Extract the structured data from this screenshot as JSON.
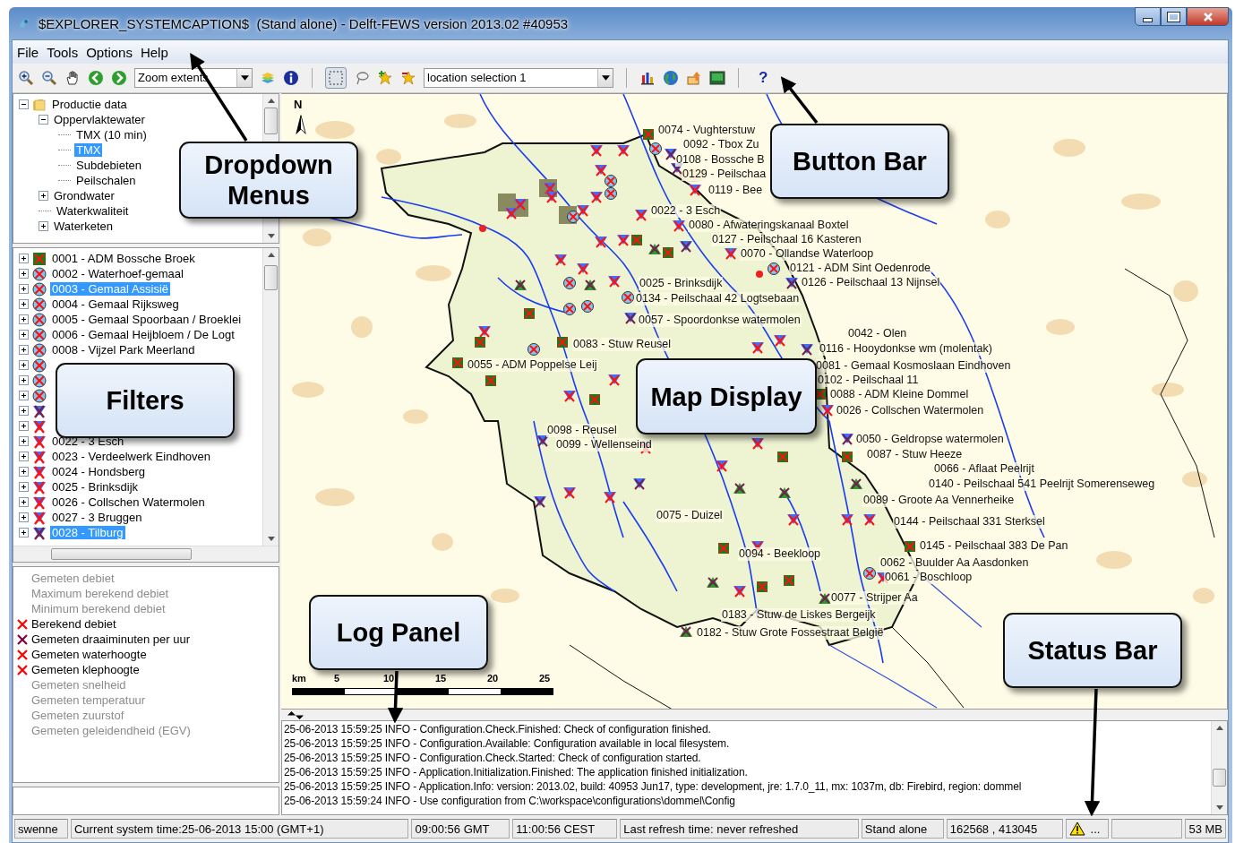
{
  "window": {
    "title": "$EXPLORER_SYSTEMCAPTION$  (Stand alone) - Delft-FEWS version 2013.02 #40953"
  },
  "menu": [
    "File",
    "Tools",
    "Options",
    "Help"
  ],
  "toolbar": {
    "zoom_select": "Zoom extents",
    "location_select": "location selection 1",
    "selection_pressed": true,
    "help": "?"
  },
  "tree": [
    {
      "label": "Productie data",
      "expanded": true,
      "selected": false,
      "children": [
        {
          "label": "Oppervlaktewater",
          "expanded": true,
          "selected": false,
          "children": [
            {
              "label": "TMX (10 min)",
              "selected": false
            },
            {
              "label": "TMX",
              "selected": true
            },
            {
              "label": "Subdebieten",
              "selected": false
            },
            {
              "label": "Peilschalen",
              "selected": false
            }
          ]
        },
        {
          "label": "Grondwater",
          "expanded": false,
          "selected": false
        },
        {
          "label": "Waterkwaliteit",
          "selected": false
        },
        {
          "label": "Waterketen",
          "expanded": false,
          "selected": false
        }
      ]
    }
  ],
  "locations": [
    {
      "label": "0001 - ADM Bossche Broek",
      "kind": "adm",
      "selected": false
    },
    {
      "label": "0002 - Waterhoef-gemaal",
      "kind": "pump",
      "selected": false
    },
    {
      "label": "0003 - Gemaal Assisië",
      "kind": "pump",
      "selected": true
    },
    {
      "label": "0004 - Gemaal Rijksweg",
      "kind": "pump",
      "selected": false
    },
    {
      "label": "0005 - Gemaal Spoorbaan / Broeklei",
      "kind": "pump",
      "selected": false
    },
    {
      "label": "0006 - Gemaal Heijbloem / De Logt",
      "kind": "pump",
      "selected": false
    },
    {
      "label": "0008 - Vijzel Park Meerland",
      "kind": "pump",
      "selected": false
    },
    {
      "kind": "pump"
    },
    {
      "kind": "pump"
    },
    {
      "kind": "pump"
    },
    {
      "kind": "weir-dark"
    },
    {
      "kind": "weir"
    },
    {
      "label": "0022 - 3 Esch",
      "kind": "weir",
      "selected": false
    },
    {
      "label": "0023 - Verdeelwerk Eindhoven",
      "kind": "weir",
      "selected": false
    },
    {
      "label": "0024 - Hondsberg",
      "kind": "weir",
      "selected": false
    },
    {
      "label": "0025 - Brinksdijk",
      "kind": "weir",
      "selected": false
    },
    {
      "label": "0026 - Collschen Watermolen",
      "kind": "weir",
      "selected": false
    },
    {
      "label": "0027 - 3 Bruggen",
      "kind": "weir",
      "selected": false
    },
    {
      "label": "0028 - Tilburg",
      "kind": "weir-dark",
      "selected": true
    }
  ],
  "parameters": [
    {
      "label": "Gemeten debiet",
      "enabled": false
    },
    {
      "label": "Maximum berekend debiet",
      "enabled": false
    },
    {
      "label": "Minimum berekend debiet",
      "enabled": false
    },
    {
      "label": "Berekend debiet",
      "enabled": true,
      "color": "#ff0000"
    },
    {
      "label": "Gemeten draaiminuten per uur",
      "enabled": true,
      "color": "#800040"
    },
    {
      "label": "Gemeten waterhoogte",
      "enabled": true,
      "color": "#ff0000"
    },
    {
      "label": "Gemeten klephoogte",
      "enabled": true,
      "color": "#ff0000"
    },
    {
      "label": "Gemeten snelheid",
      "enabled": false
    },
    {
      "label": "Gemeten temperatuur",
      "enabled": false
    },
    {
      "label": "Gemeten zuurstof",
      "enabled": false
    },
    {
      "label": "Gemeten geleidendheid (EGV)",
      "enabled": false
    }
  ],
  "map": {
    "north": "N",
    "labels": [
      "0074 - Vughterstuw",
      "0092 - Tbox Zu",
      "0108 - Bossche B",
      "0129 - Peilschaa",
      "0119 - Bee",
      "0022 - 3 Esch",
      "0080 - Afwateringskanaal Boxtel",
      "0127 - Peilschaal 16 Kasteren",
      "0070 - Ollandse Waterloop",
      "0121 - ADM Sint Oedenrode",
      "0025 - Brinksdijk",
      "0126 - Peilschaal 13 Nijnsel",
      "0134 - Peilschaal 42 Logtsebaan",
      "0057 - Spoordonkse watermolen",
      "0042 - Olen",
      "0083 - Stuw Reusel",
      "0116 - Hooydonkse wm (molentak)",
      "0055 - ADM Poppelse Leij",
      "0081 - Gemaal Kosmoslaan Eindhoven",
      "0102 - Peilschaal 11",
      "0088 - ADM Kleine Dommel",
      "0026 - Collschen Watermolen",
      "0098 - Reusel",
      "0099 - Wellenseind",
      "0050 - Geldropse watermolen",
      "0087 - Stuw Heeze",
      "0066 - Aflaat Peelrijt",
      "0140 - Peilschaal 541 Peelrijt Somerenseweg",
      "0089 - Groote Aa Vennerheike",
      "0075 - Duizel",
      "0144 - Peilschaal 331 Sterksel",
      "0145 - Peilschaal 383 De Pan",
      "0094 - Beekloop",
      "0062 - Buulder Aa Aasdonken",
      "0061 - Boschloop",
      "0077 - Strijper Aa",
      "0183 - Stuw de Liskes Bergeijk",
      "0182 - Stuw Grote Fossestraat België"
    ],
    "scale": {
      "unit": "km",
      "ticks": [
        "5",
        "10",
        "15",
        "20",
        "25"
      ]
    }
  },
  "log": [
    "25-06-2013 15:59:25 INFO - Configuration.Check.Finished: Check of configuration finished.",
    "25-06-2013 15:59:25 INFO - Configuration.Available: Configuration available in local filesystem.",
    "25-06-2013 15:59:25 INFO - Configuration.Check.Started: Check of configuration started.",
    "25-06-2013 15:59:25 INFO - Application.Initialization.Finished: The application finished initialization.",
    "25-06-2013 15:59:25 INFO - Application.Info: version: 2013.02, build: 40953 Jun17, type: development, jre: 1.7.0_11, mx: 1037m, db: Firebird, region: dommel",
    "25-06-2013 15:59:24 INFO - Use configuration from C:\\workspace\\configurations\\dommel\\Config"
  ],
  "status_bar": {
    "user": "swenne",
    "system_time": "Current system time:25-06-2013 15:00 (GMT+1)",
    "gmt": "09:00:56 GMT",
    "local": "11:00:56 CEST",
    "refresh": "Last refresh time: never refreshed",
    "mode": "Stand alone",
    "coordinates": "162568 , 413045",
    "warnings": "...",
    "memory": "53 MB"
  },
  "callouts": [
    {
      "text": "Dropdown Menus"
    },
    {
      "text": "Button Bar"
    },
    {
      "text": "Filters"
    },
    {
      "text": "Map Display"
    },
    {
      "text": "Log Panel"
    },
    {
      "text": "Status Bar"
    }
  ]
}
